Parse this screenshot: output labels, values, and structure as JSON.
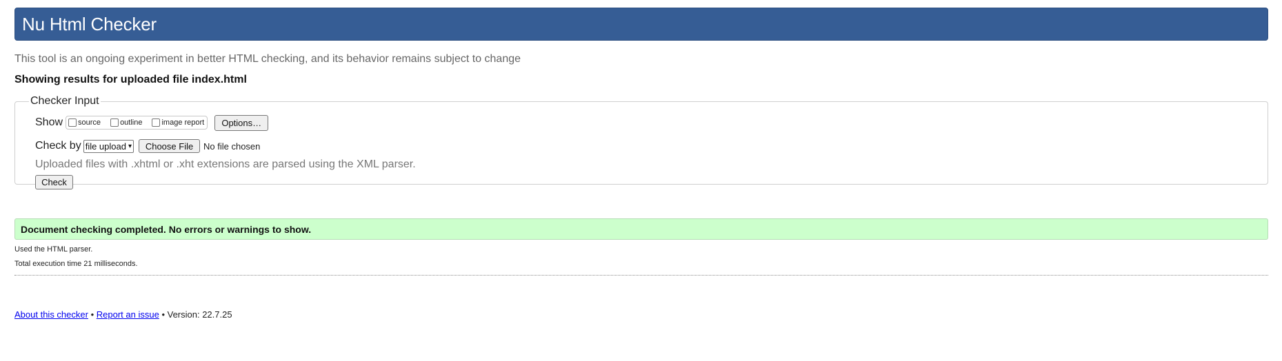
{
  "header": {
    "title": "Nu Html Checker"
  },
  "tagline": "This tool is an ongoing experiment in better HTML checking, and its behavior remains subject to change",
  "results_for": "Showing results for uploaded file index.html",
  "checker_input": {
    "legend": "Checker Input",
    "show_label": "Show",
    "show_options": [
      {
        "label": "source",
        "checked": false
      },
      {
        "label": "outline",
        "checked": false
      },
      {
        "label": "image report",
        "checked": false
      }
    ],
    "options_button": "Options…",
    "check_by_label": "Check by",
    "check_by_selected": "file upload",
    "choose_file_button": "Choose File",
    "no_file_text": "No file chosen",
    "parser_note": "Uploaded files with .xhtml or .xht extensions are parsed using the XML parser.",
    "check_button": "Check"
  },
  "result": {
    "success_message": "Document checking completed. No errors or warnings to show.",
    "success_color": "#ccffcc",
    "used_parser": "Used the HTML parser.",
    "execution_time": "Total execution time 21 milliseconds."
  },
  "footer": {
    "about_link": "About this checker",
    "separator": "•",
    "report_link": "Report an issue",
    "version": "• Version: 22.7.25"
  },
  "colors": {
    "header_bg": "#365d95",
    "link": "#0000ee"
  }
}
